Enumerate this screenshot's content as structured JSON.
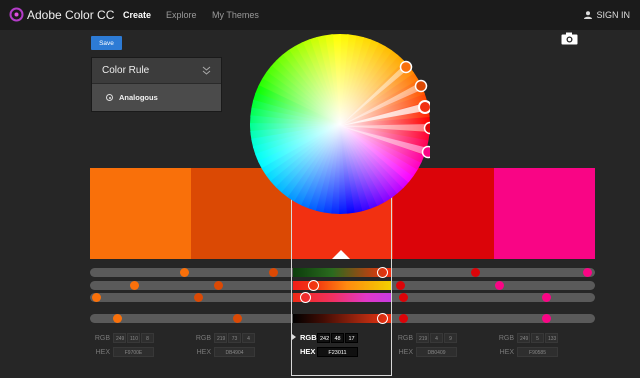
{
  "app": {
    "title": "Adobe Color CC"
  },
  "nav": [
    {
      "label": "Create",
      "active": true
    },
    {
      "label": "Explore",
      "active": false
    },
    {
      "label": "My Themes",
      "active": false
    }
  ],
  "header": {
    "signin_label": "SIGN IN"
  },
  "toolbar": {
    "save_label": "Save",
    "camera_icon": "camera-icon"
  },
  "color_rule": {
    "title": "Color Rule",
    "selected_option": "Analogous"
  },
  "colors": {
    "accent": "#2d7bd5",
    "swatches": [
      "#F9700A",
      "#DB4904",
      "#F23011",
      "#DB0409",
      "#F90585"
    ],
    "knob_fills": [
      [
        "#F9700A",
        "#DB4904",
        "#F23011",
        "#DB0409",
        "#F90585"
      ]
    ]
  },
  "selected_index": 2,
  "sliders": {
    "rows": [
      [
        0.188,
        0.364,
        0.58,
        0.763,
        0.986
      ],
      [
        0.089,
        0.255,
        0.443,
        0.614,
        0.811
      ],
      [
        0.012,
        0.214,
        0.426,
        0.621,
        0.903
      ],
      [
        0.055,
        0.293,
        0.58,
        0.621,
        0.903
      ]
    ]
  },
  "values": [
    {
      "rgb": [
        "249",
        "110",
        "8"
      ],
      "hex": "F9700E"
    },
    {
      "rgb": [
        "219",
        "73",
        "4"
      ],
      "hex": "DB4904"
    },
    {
      "rgb": [
        "242",
        "48",
        "17"
      ],
      "hex": "F23011"
    },
    {
      "rgb": [
        "219",
        "4",
        "9"
      ],
      "hex": "DB0409"
    },
    {
      "rgb": [
        "249",
        "5",
        "133"
      ],
      "hex": "F90585"
    }
  ],
  "labels": {
    "rgb": "RGB",
    "hex": "HEX"
  }
}
